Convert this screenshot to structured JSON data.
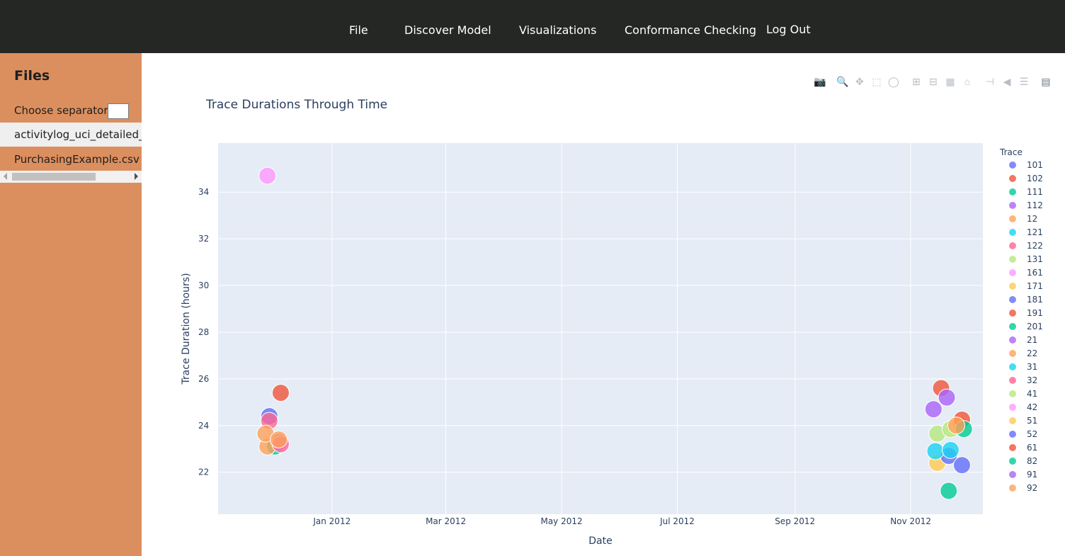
{
  "nav": {
    "items": [
      "File",
      "Discover Model",
      "Visualizations",
      "Conformance Checking",
      "Log Out"
    ]
  },
  "sidebar": {
    "title": "Files",
    "separator_label": "Choose separator",
    "separator_value": "",
    "files": [
      "activitylog_uci_detailed_labour.xes",
      "PurchasingExample.csv"
    ]
  },
  "modebar": {
    "icons": [
      "camera-icon",
      "zoom-icon",
      "pan-icon",
      "box-select-icon",
      "lasso-select-icon",
      "zoom-in-icon",
      "zoom-out-icon",
      "autoscale-icon",
      "reset-axes-icon",
      "spike-lines-icon",
      "hover-closest-icon",
      "hover-compare-icon",
      "plotly-logo-icon"
    ]
  },
  "colors": {
    "topbar": "#252724",
    "sidebar": "#dc8f5e",
    "plot_bg": "#e5ecf6"
  },
  "chart_data": {
    "type": "scatter",
    "title": "Trace Durations Through Time",
    "xlabel": "Date",
    "ylabel": "Trace Duration (hours)",
    "legend_title": "Trace",
    "legend_position": "right",
    "grid": true,
    "xlim": [
      "2011-11-02",
      "2012-12-09"
    ],
    "ylim": [
      20.2,
      36.1
    ],
    "x_ticks": [
      {
        "date": "2012-01-01",
        "label": "Jan 2012"
      },
      {
        "date": "2012-03-01",
        "label": "Mar 2012"
      },
      {
        "date": "2012-05-01",
        "label": "May 2012"
      },
      {
        "date": "2012-07-01",
        "label": "Jul 2012"
      },
      {
        "date": "2012-09-01",
        "label": "Sep 2012"
      },
      {
        "date": "2012-11-01",
        "label": "Nov 2012"
      }
    ],
    "y_ticks": [
      22,
      24,
      26,
      28,
      30,
      32,
      34
    ],
    "series": [
      {
        "name": "101",
        "color": "#636efa",
        "points": [
          {
            "x": "2011-11-29",
            "y": 24.4
          }
        ]
      },
      {
        "name": "102",
        "color": "#ef553b",
        "points": [
          {
            "x": "2011-12-05",
            "y": 25.4
          }
        ]
      },
      {
        "name": "111",
        "color": "#00cc96",
        "points": [
          {
            "x": "2011-12-02",
            "y": 23.1
          }
        ]
      },
      {
        "name": "112",
        "color": "#ab63fa",
        "points": [
          {
            "x": "2011-12-04",
            "y": 23.3
          }
        ]
      },
      {
        "name": "12",
        "color": "#ffa15a",
        "points": [
          {
            "x": "2011-11-28",
            "y": 23.1
          }
        ]
      },
      {
        "name": "121",
        "color": "#19d3f3",
        "points": []
      },
      {
        "name": "122",
        "color": "#ff6692",
        "points": [
          {
            "x": "2011-11-29",
            "y": 24.2
          },
          {
            "x": "2011-12-05",
            "y": 23.2
          }
        ]
      },
      {
        "name": "131",
        "color": "#b6e880",
        "points": [
          {
            "x": "2012-11-15",
            "y": 23.65
          }
        ]
      },
      {
        "name": "161",
        "color": "#ff97ff",
        "points": [
          {
            "x": "2011-11-28",
            "y": 34.7
          }
        ]
      },
      {
        "name": "171",
        "color": "#fecb52",
        "points": [
          {
            "x": "2012-11-15",
            "y": 22.4
          }
        ]
      },
      {
        "name": "181",
        "color": "#636efa",
        "points": [
          {
            "x": "2012-11-21",
            "y": 22.7
          },
          {
            "x": "2012-11-28",
            "y": 22.3
          }
        ]
      },
      {
        "name": "191",
        "color": "#ef553b",
        "points": [
          {
            "x": "2012-11-17",
            "y": 25.6
          }
        ]
      },
      {
        "name": "201",
        "color": "#00cc96",
        "points": [
          {
            "x": "2012-11-21",
            "y": 21.2
          }
        ]
      },
      {
        "name": "21",
        "color": "#ab63fa",
        "points": [
          {
            "x": "2012-11-20",
            "y": 25.2
          }
        ]
      },
      {
        "name": "22",
        "color": "#ffa15a",
        "points": [
          {
            "x": "2011-11-27",
            "y": 23.65
          },
          {
            "x": "2011-12-04",
            "y": 23.4
          }
        ]
      },
      {
        "name": "31",
        "color": "#19d3f3",
        "points": [
          {
            "x": "2012-11-14",
            "y": 22.9
          },
          {
            "x": "2012-11-22",
            "y": 22.95
          }
        ]
      },
      {
        "name": "32",
        "color": "#ff6692",
        "points": []
      },
      {
        "name": "41",
        "color": "#b6e880",
        "points": [
          {
            "x": "2012-11-22",
            "y": 23.85
          }
        ]
      },
      {
        "name": "42",
        "color": "#ff97ff",
        "points": []
      },
      {
        "name": "51",
        "color": "#fecb52",
        "points": [
          {
            "x": "2012-11-27",
            "y": 24.05
          }
        ]
      },
      {
        "name": "52",
        "color": "#636efa",
        "points": []
      },
      {
        "name": "61",
        "color": "#ef553b",
        "points": [
          {
            "x": "2012-11-28",
            "y": 24.25
          }
        ]
      },
      {
        "name": "82",
        "color": "#00cc96",
        "points": [
          {
            "x": "2012-11-29",
            "y": 23.85
          }
        ]
      },
      {
        "name": "91",
        "color": "#ab63fa",
        "points": [
          {
            "x": "2012-11-13",
            "y": 24.7
          }
        ]
      },
      {
        "name": "92",
        "color": "#ffa15a",
        "points": [
          {
            "x": "2012-11-25",
            "y": 24.0
          }
        ]
      }
    ]
  }
}
